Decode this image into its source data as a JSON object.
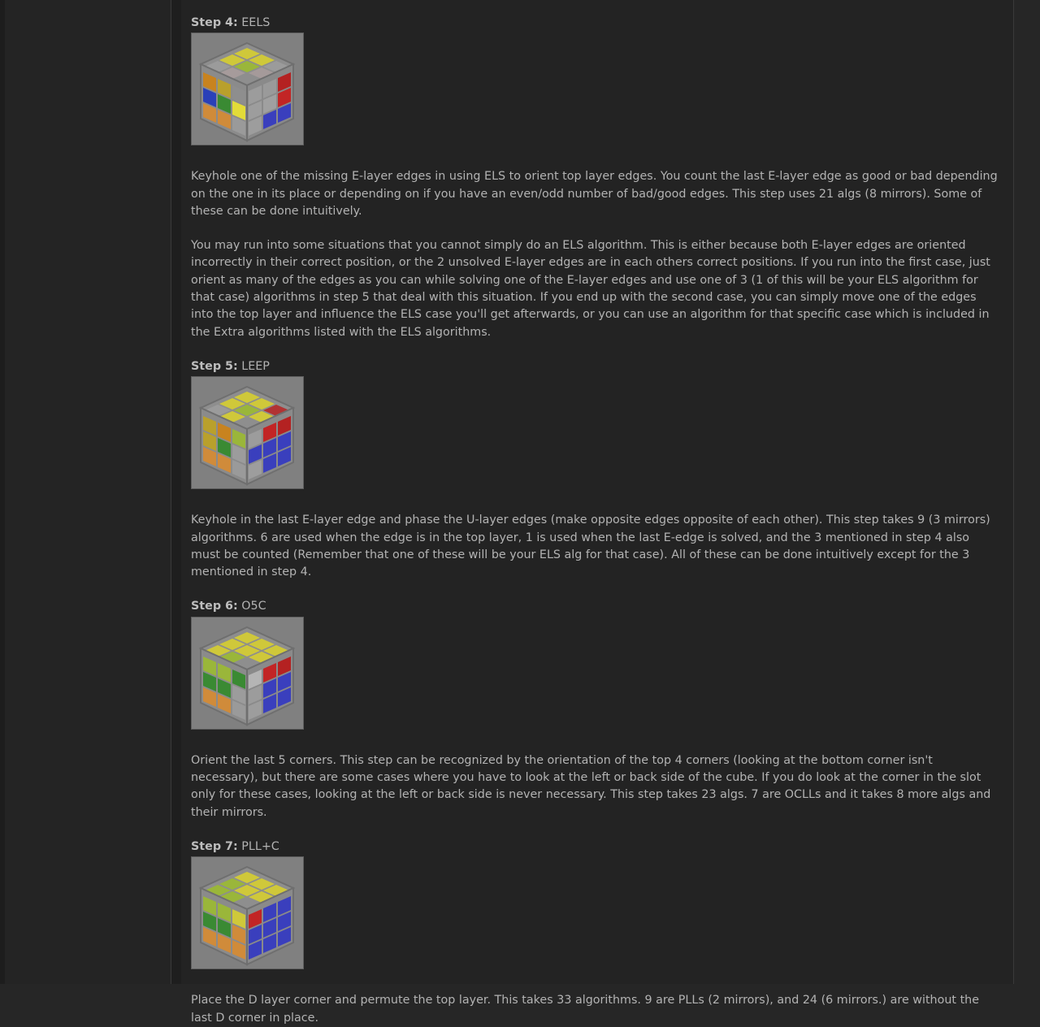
{
  "steps": [
    {
      "label": "Step 4:",
      "name": "EELS",
      "icon": "cube-diagram-icon",
      "paragraphs": [
        "Keyhole one of the missing E-layer edges in using ELS to orient top layer edges. You count the last E-layer edge as good or bad depending on the one in its place or depending on if you have an even/odd number of bad/good edges. This step uses 21 algs (8 mirrors). Some of these can be done intuitively.",
        "You may run into some situations that you cannot simply do an ELS algorithm. This is either because both E-layer edges are oriented incorrectly in their correct position, or the 2 unsolved E-layer edges are in each others correct positions. If you run into the first case, just orient as many of the edges as you can while solving one of the E-layer edges and use one of 3 (1 of this will be your ELS algorithm for that case) algorithms in step 5 that deal with this situation. If you end up with the second case, you can simply move one of the edges into the top layer and influence the ELS case you'll get afterwards, or you can use an algorithm for that specific case which is included in the Extra algorithms listed with the ELS algorithms."
      ]
    },
    {
      "label": "Step 5:",
      "name": "LEEP",
      "icon": "cube-diagram-icon",
      "paragraphs": [
        "Keyhole in the last E-layer edge and phase the U-layer edges (make opposite edges opposite of each other). This step takes 9 (3 mirrors) algorithms. 6 are used when the edge is in the top layer, 1 is used when the last E-edge is solved, and the 3 mentioned in step 4 also must be counted (Remember that one of these will be your ELS alg for that case). All of these can be done intuitively except for the 3 mentioned in step 4."
      ]
    },
    {
      "label": "Step 6:",
      "name": "O5C",
      "icon": "cube-diagram-icon",
      "paragraphs": [
        "Orient the last 5 corners. This step can be recognized by the orientation of the top 4 corners (looking at the bottom corner isn't necessary), but there are some cases where you have to look at the left or back side of the cube. If you do look at the corner in the slot only for these cases, looking at the left or back side is never necessary. This step takes 23 algs. 7 are OCLLs and it takes 8 more algs and their mirrors."
      ]
    },
    {
      "label": "Step 7:",
      "name": "PLL+C",
      "icon": "cube-diagram-icon",
      "paragraphs": [
        "Place the D layer corner and permute the top layer. This takes 33 algorithms. 9 are PLLs (2 mirrors), and 24 (6 mirrors.) are without the last D corner in place."
      ]
    }
  ],
  "colors": {
    "background": "#232323",
    "text": "#b3b3b3",
    "image_bg": "#808080"
  }
}
